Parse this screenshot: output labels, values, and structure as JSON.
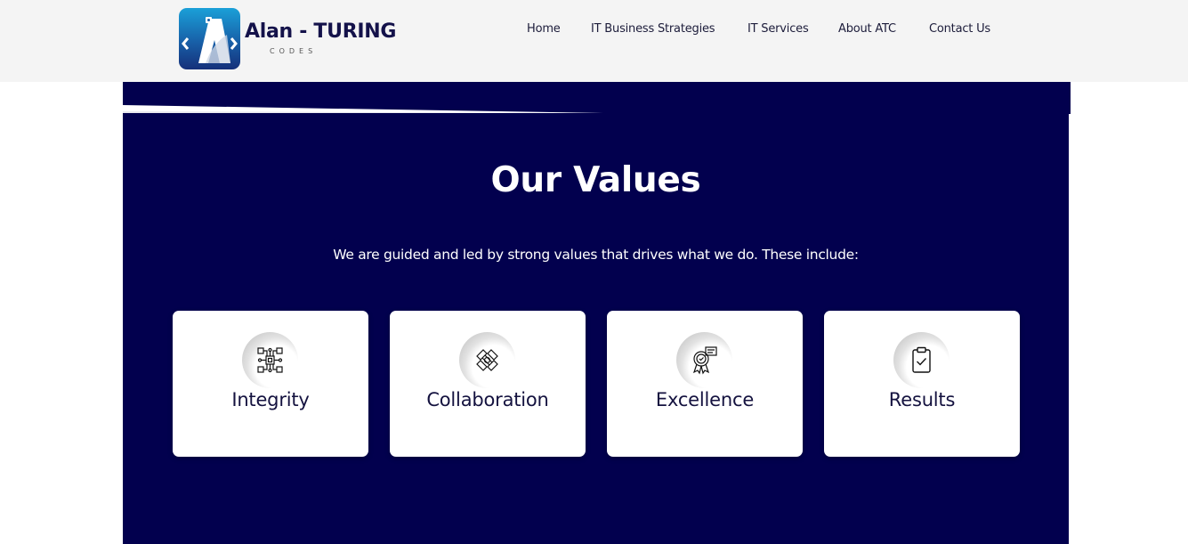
{
  "header": {
    "logo": {
      "wordmark": "Alan - TURING",
      "subtext": "CODES",
      "badge_letter": "A"
    },
    "nav": [
      {
        "label": "Home"
      },
      {
        "label": "IT Business Strategies"
      },
      {
        "label": "IT Services"
      },
      {
        "label": "About ATC"
      },
      {
        "label": "Contact Us"
      }
    ]
  },
  "values_section": {
    "title": "Our Values",
    "subtitle": "We are guided and led by strong values that drives what we do. These include:",
    "cards": [
      {
        "label": "Integrity",
        "icon": "circuit-chip-icon"
      },
      {
        "label": "Collaboration",
        "icon": "handshake-icon"
      },
      {
        "label": "Excellence",
        "icon": "award-ribbon-icon"
      },
      {
        "label": "Results",
        "icon": "clipboard-check-icon"
      }
    ]
  },
  "colors": {
    "header_bg": "#f4f4f4",
    "section_bg": "#02004e",
    "card_bg": "#ffffff",
    "heading_text": "#ffffff",
    "card_text": "#14123f",
    "nav_text": "#1c1c3a"
  }
}
